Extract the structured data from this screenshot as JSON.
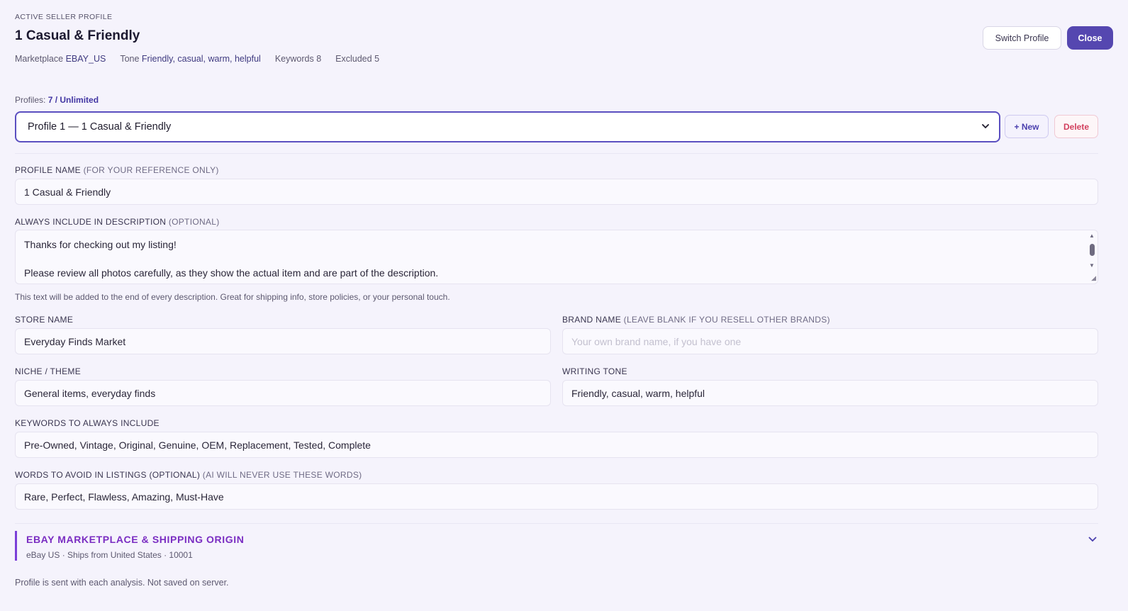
{
  "header": {
    "eyebrow": "ACTIVE SELLER PROFILE",
    "title": "1 Casual & Friendly",
    "meta": {
      "marketplace_label": "Marketplace",
      "marketplace_value": "EBAY_US",
      "tone_label": "Tone",
      "tone_value": "Friendly, casual, warm, helpful",
      "keywords_label": "Keywords",
      "keywords_value": "8",
      "excluded_label": "Excluded",
      "excluded_value": "5"
    },
    "switch_label": "Switch Profile",
    "close_label": "Close"
  },
  "profiles": {
    "count_label": "Profiles:",
    "count_value": "7 / Unlimited",
    "selected": "Profile 1 — 1 Casual & Friendly",
    "new_label": "+ New",
    "delete_label": "Delete"
  },
  "form": {
    "profile_name": {
      "label": "PROFILE NAME",
      "note": "(FOR YOUR REFERENCE ONLY)",
      "value": "1 Casual & Friendly"
    },
    "always_include": {
      "label": "ALWAYS INCLUDE IN DESCRIPTION",
      "note": "(OPTIONAL)",
      "line1": "Thanks for checking out my listing!",
      "line2": "Please review all photos carefully, as they show the actual item and are part of the description.",
      "hint": "This text will be added to the end of every description. Great for shipping info, store policies, or your personal touch."
    },
    "store_name": {
      "label": "STORE NAME",
      "value": "Everyday Finds Market"
    },
    "brand_name": {
      "label": "BRAND NAME",
      "note": "(LEAVE BLANK IF YOU RESELL OTHER BRANDS)",
      "placeholder": "Your own brand name, if you have one"
    },
    "niche": {
      "label": "NICHE / THEME",
      "value": "General items, everyday finds"
    },
    "tone": {
      "label": "WRITING TONE",
      "value": "Friendly, casual, warm, helpful"
    },
    "keywords": {
      "label": "KEYWORDS TO ALWAYS INCLUDE",
      "value": "Pre-Owned, Vintage, Original, Genuine, OEM, Replacement, Tested, Complete"
    },
    "avoid": {
      "label": "WORDS TO AVOID IN LISTINGS (OPTIONAL)",
      "note": "(AI WILL NEVER USE THESE WORDS)",
      "value": "Rare, Perfect, Flawless, Amazing, Must-Have"
    }
  },
  "marketplace_section": {
    "title": "EBAY MARKETPLACE & SHIPPING ORIGIN",
    "subtitle": "eBay US · Ships from United States · 10001"
  },
  "footer": {
    "text": "Profile is sent with each analysis. Not saved on server."
  },
  "colors": {
    "accent": "#5547b0",
    "section_accent": "#7a2dc2",
    "danger": "#d2405e",
    "background": "#f5f3fc"
  }
}
